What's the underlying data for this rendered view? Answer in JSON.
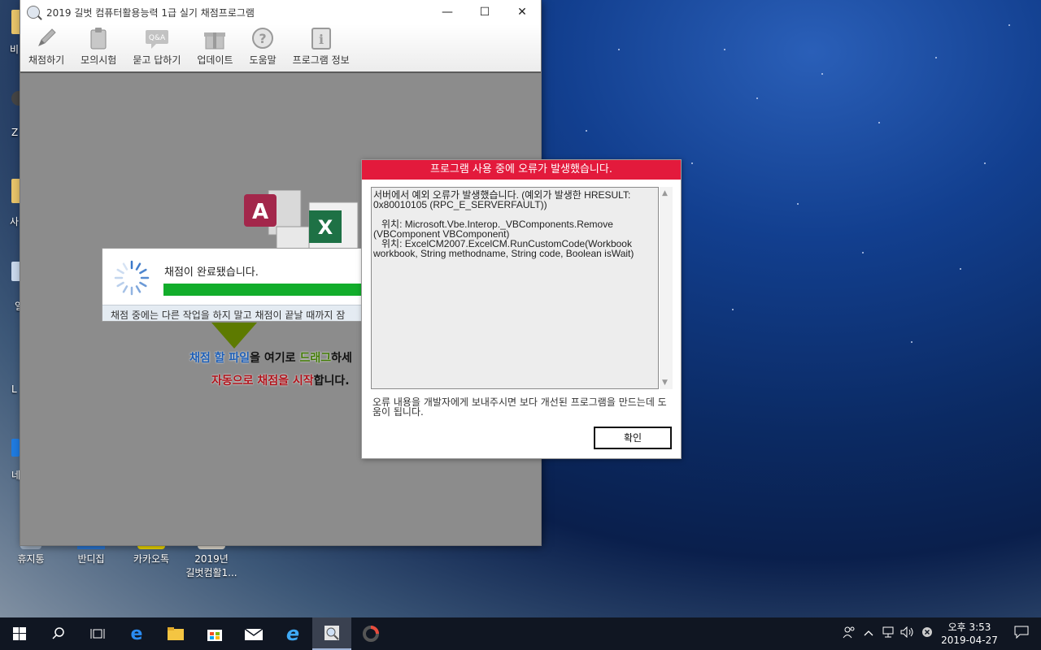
{
  "window": {
    "title": "2019 길벗 컴퓨터활용능력 1급 실기 채점프로그램",
    "minimize": "—",
    "maximize": "☐",
    "close": "✕"
  },
  "toolbar": {
    "items": [
      {
        "label": "채점하기",
        "icon": "pencil-icon"
      },
      {
        "label": "모의시험",
        "icon": "clipboard-icon"
      },
      {
        "label": "묻고 답하기",
        "icon": "qa-icon",
        "badge": "Q&A"
      },
      {
        "label": "업데이트",
        "icon": "gift-icon"
      },
      {
        "label": "도움말",
        "icon": "help-icon"
      },
      {
        "label": "프로그램 정보",
        "icon": "info-icon"
      }
    ]
  },
  "drop_area": {
    "line1_a": "채점 할 파일",
    "line1_b": "을 여기로 ",
    "line1_c": "드래그",
    "line1_d": "하세",
    "line2_a": "자동으로 채점을 시작",
    "line2_b": "합니다."
  },
  "progress": {
    "message": "채점이 완료됐습니다.",
    "value": 1.0,
    "footer": "채점 중에는 다른 작업을 하지 말고 채점이 끝날 때까지 잠"
  },
  "error_dialog": {
    "title": "프로그램 사용 중에 오류가 발생했습니다.",
    "details": "서버에서 예외 오류가 발생했습니다. (예외가 발생한 HRESULT:\n0x80010105 (RPC_E_SERVERFAULT))\n\n   위치: Microsoft.Vbe.Interop._VBComponents.Remove\n(VBComponent VBComponent)\n   위치: ExcelCM2007.ExcelCM.RunCustomCode(Workbook\nworkbook, String methodname, String code, Boolean isWait)",
    "note": "오류 내용을 개발자에게 보내주시면 보다 개선된 프로그램을 만드는데 도움이 됩니다.",
    "ok_label": "확인"
  },
  "desktop": {
    "icons": [
      {
        "label": "휴지통"
      },
      {
        "label": "반디집"
      },
      {
        "label": "카카오톡"
      },
      {
        "label": "2019년\n길벗컴활1..."
      }
    ],
    "edge_labels": [
      "비",
      "Z",
      "사",
      "일",
      "L",
      "네"
    ]
  },
  "taskbar": {
    "clock_time": "오후 3:53",
    "clock_date": "2019-04-27"
  },
  "colors": {
    "error_title_bg": "#e31a3c",
    "progress_fill": "#12ad2b",
    "arrow": "#5d7a00"
  }
}
